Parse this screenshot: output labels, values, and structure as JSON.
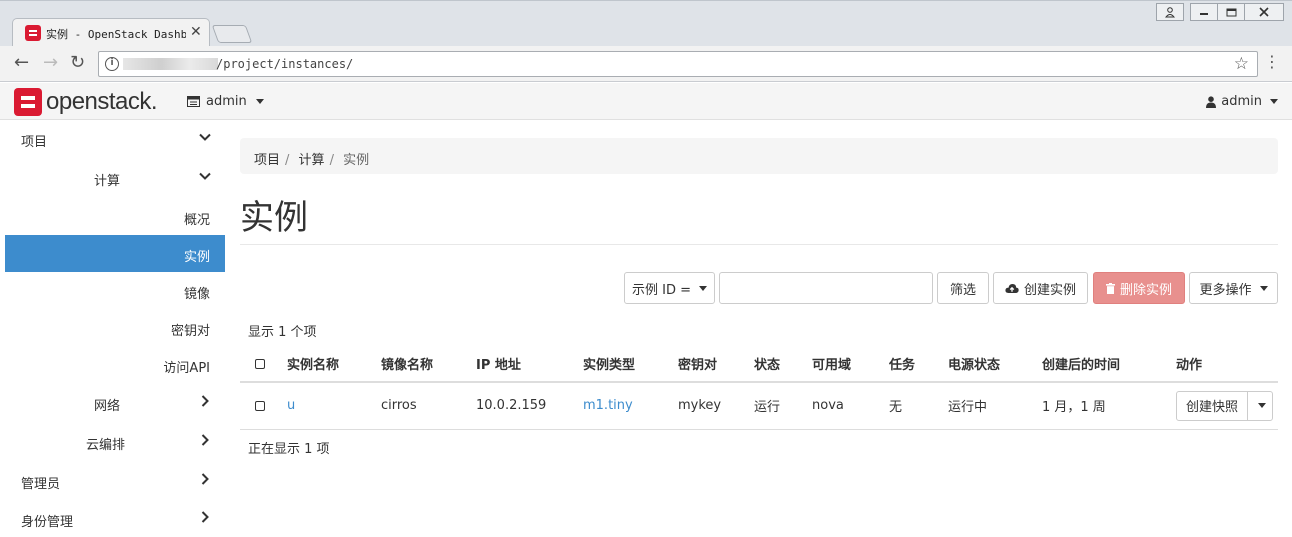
{
  "browser": {
    "tab_title": "实例 - OpenStack Dashb",
    "tab_close": "✕",
    "url_path": "/project/instances/"
  },
  "header": {
    "logo_text": "openstack.",
    "project": "admin",
    "user": "admin"
  },
  "sidebar": {
    "items": [
      {
        "label": "项目"
      },
      {
        "label": "计算"
      },
      {
        "label": "概况"
      },
      {
        "label": "实例"
      },
      {
        "label": "镜像"
      },
      {
        "label": "密钥对"
      },
      {
        "label": "访问API"
      },
      {
        "label": "网络"
      },
      {
        "label": "云编排"
      },
      {
        "label": "管理员"
      },
      {
        "label": "身份管理"
      }
    ]
  },
  "breadcrumb": [
    "项目",
    "计算",
    "实例"
  ],
  "page_title": "实例",
  "actions": {
    "filter_select": "示例 ID =",
    "filter_button": "筛选",
    "create_button": "创建实例",
    "delete_button": "删除实例",
    "more_button": "更多操作"
  },
  "count_top": "显示 1 个项",
  "count_bottom": "正在显示 1 项",
  "table": {
    "headers": [
      "实例名称",
      "镜像名称",
      "IP 地址",
      "实例类型",
      "密钥对",
      "状态",
      "可用域",
      "任务",
      "电源状态",
      "创建后的时间",
      "动作"
    ],
    "rows": [
      {
        "name": "u",
        "image": "cirros",
        "ip": "10.0.2.159",
        "flavor": "m1.tiny",
        "keypair": "mykey",
        "status": "运行",
        "zone": "nova",
        "task": "无",
        "power": "运行中",
        "age": "1 月，1 周",
        "action": "创建快照"
      }
    ]
  },
  "colors": {
    "active_sidebar": "#3d8ccd",
    "link": "#3d8ccd",
    "danger": "#e8908e",
    "brand_red": "#da1a32"
  }
}
